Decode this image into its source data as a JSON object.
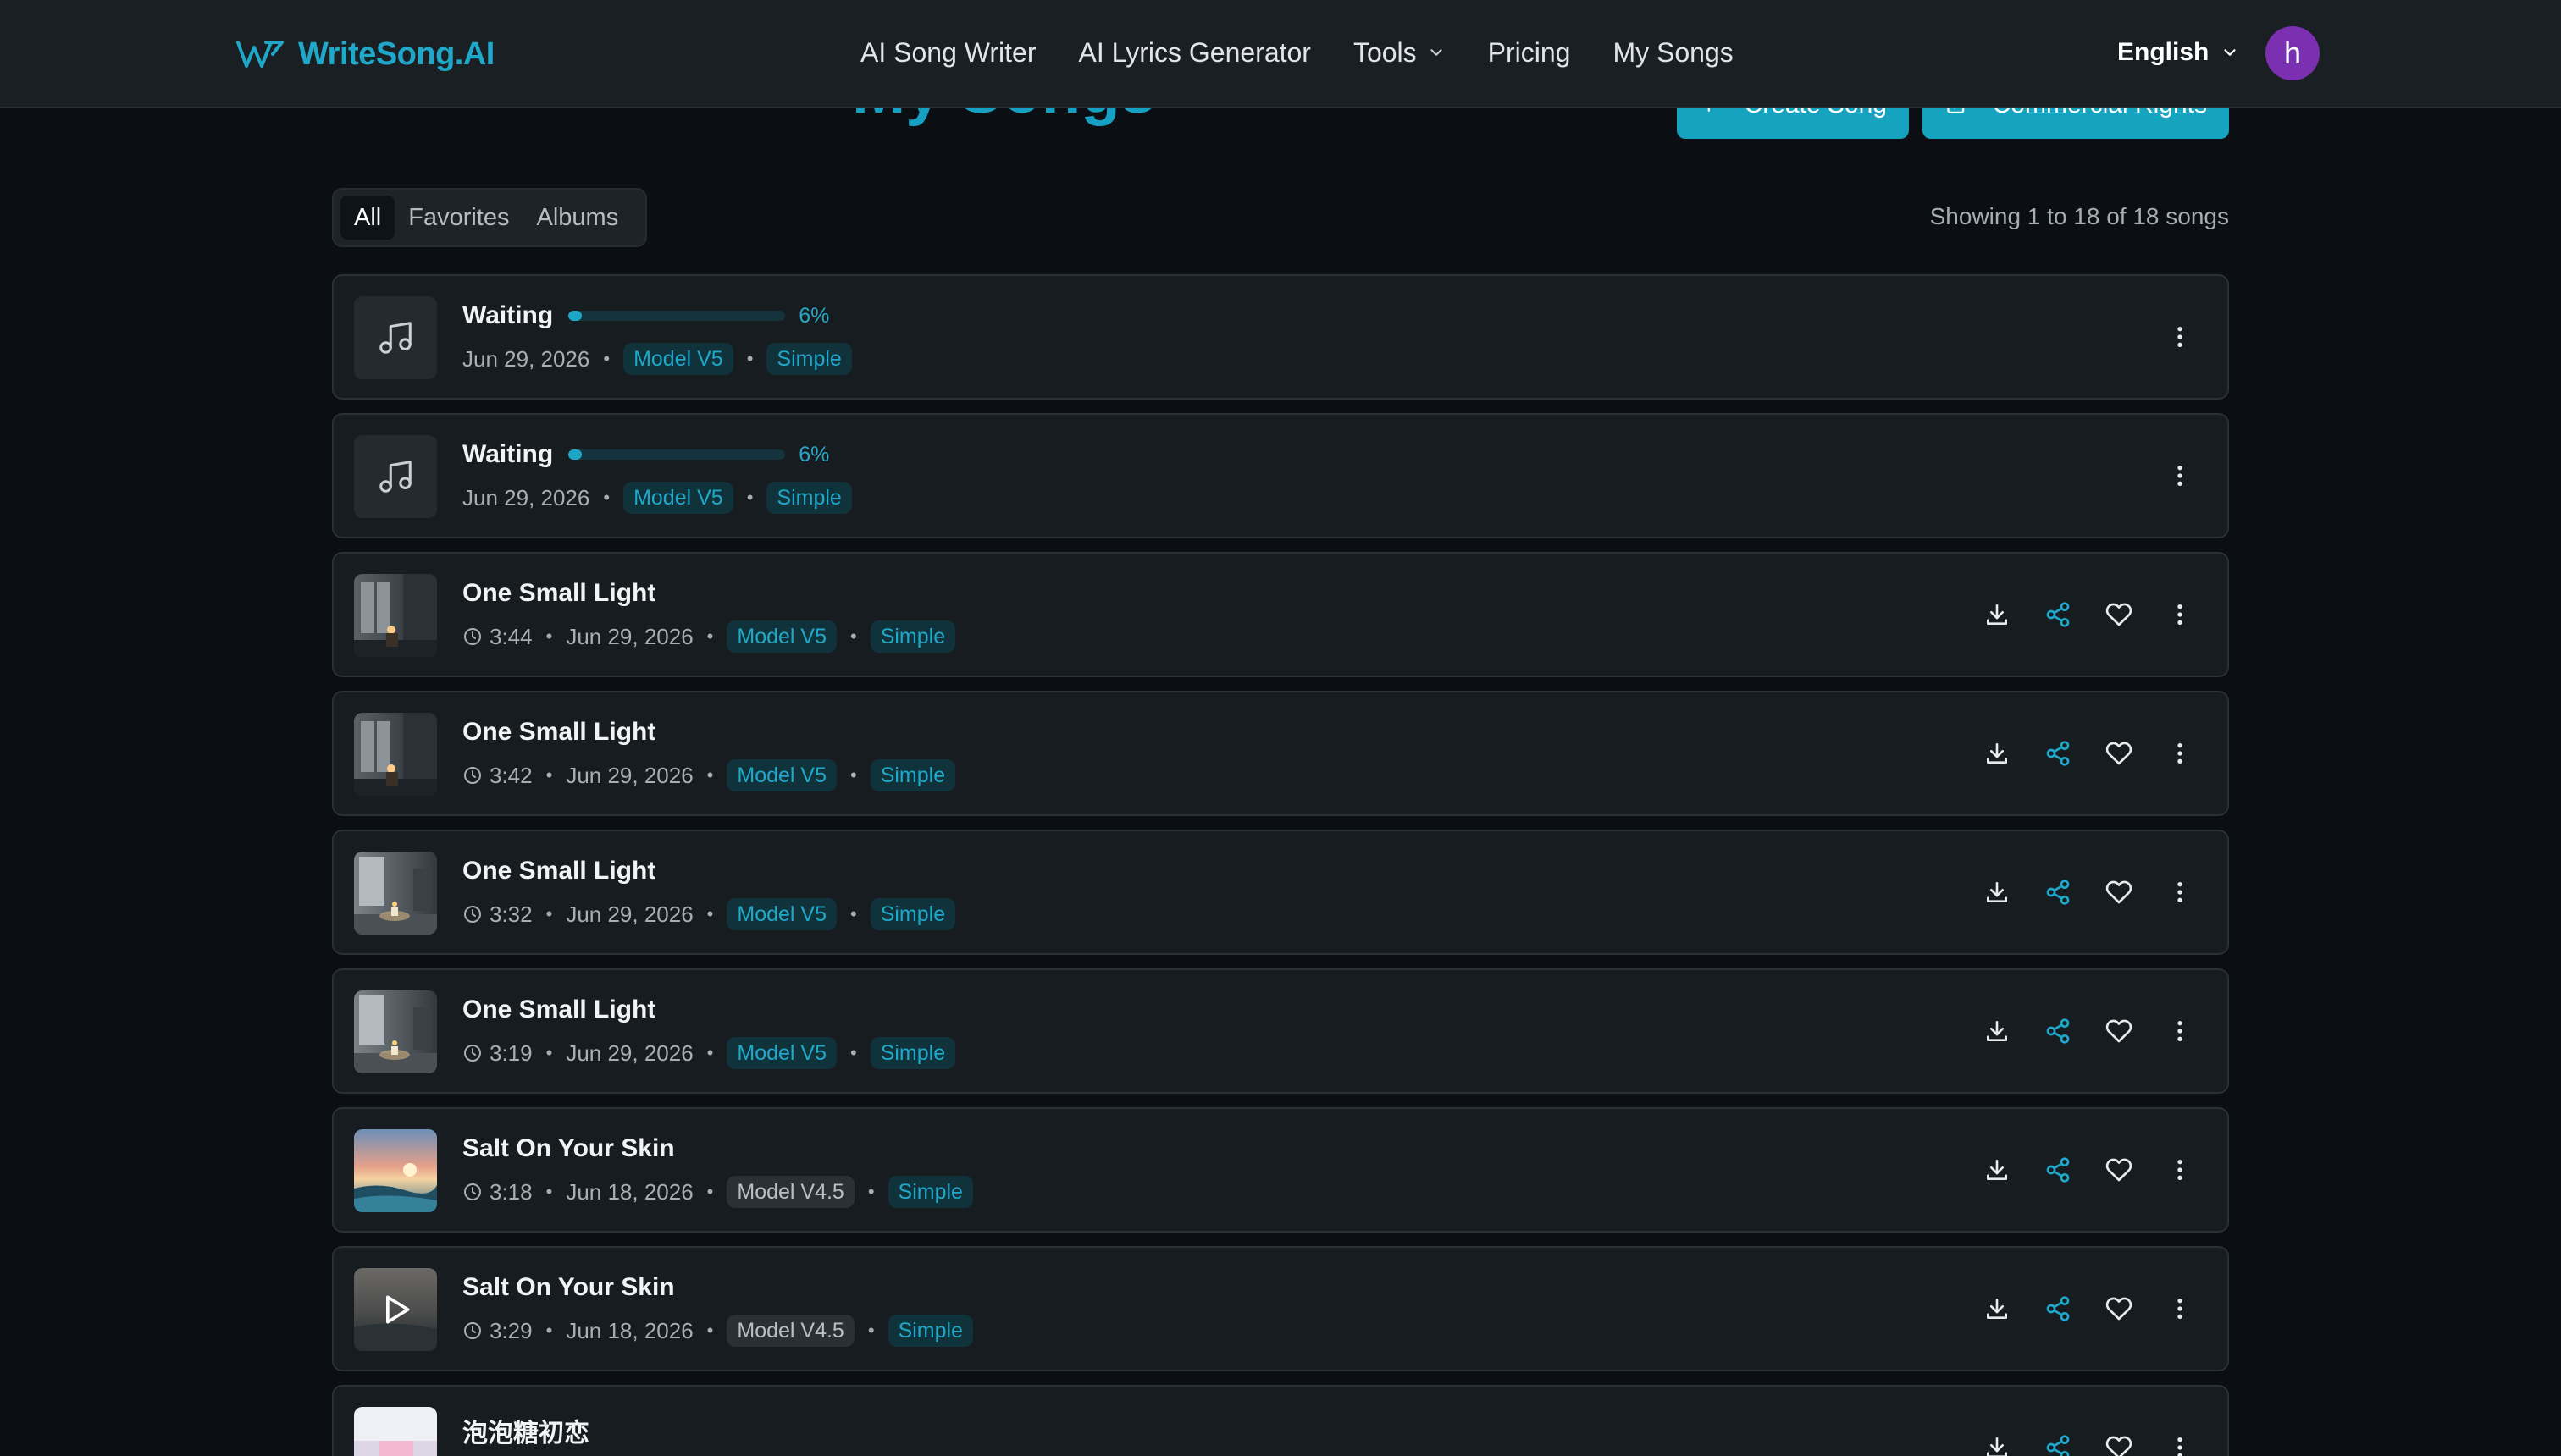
{
  "header": {
    "brand": "WriteSong.AI",
    "nav": [
      {
        "label": "AI Song Writer"
      },
      {
        "label": "AI Lyrics Generator"
      },
      {
        "label": "Tools"
      },
      {
        "label": "Pricing"
      },
      {
        "label": "My Songs"
      }
    ],
    "language": "English",
    "avatar_initial": "h",
    "avatar_color": "#7b2fb1"
  },
  "page": {
    "title": "My Songs",
    "create_button": "Create Song",
    "rights_button": "Commercial Rights"
  },
  "tabs": [
    {
      "label": "All",
      "active": true
    },
    {
      "label": "Favorites",
      "active": false
    },
    {
      "label": "Albums",
      "active": false
    }
  ],
  "showing_text": "Showing 1 to 18 of 18 songs",
  "accent_color": "#1fa8c9",
  "songs": [
    {
      "title": "Waiting",
      "status": "waiting",
      "progress_pct": 6,
      "progress_label": "6%",
      "date": "Jun 29, 2026",
      "model": "Model V5",
      "mode": "Simple"
    },
    {
      "title": "Waiting",
      "status": "waiting",
      "progress_pct": 6,
      "progress_label": "6%",
      "date": "Jun 29, 2026",
      "model": "Model V5",
      "mode": "Simple"
    },
    {
      "title": "One Small Light",
      "status": "done",
      "duration": "3:44",
      "date": "Jun 29, 2026",
      "model": "Model V5",
      "mode": "Simple",
      "thumb": "room-window"
    },
    {
      "title": "One Small Light",
      "status": "done",
      "duration": "3:42",
      "date": "Jun 29, 2026",
      "model": "Model V5",
      "mode": "Simple",
      "thumb": "room-window"
    },
    {
      "title": "One Small Light",
      "status": "done",
      "duration": "3:32",
      "date": "Jun 29, 2026",
      "model": "Model V5",
      "mode": "Simple",
      "thumb": "room-candle"
    },
    {
      "title": "One Small Light",
      "status": "done",
      "duration": "3:19",
      "date": "Jun 29, 2026",
      "model": "Model V5",
      "mode": "Simple",
      "thumb": "room-candle"
    },
    {
      "title": "Salt On Your Skin",
      "status": "done",
      "duration": "3:18",
      "date": "Jun 18, 2026",
      "model": "Model V4.5",
      "mode": "Simple",
      "thumb": "sunset-sea"
    },
    {
      "title": "Salt On Your Skin",
      "status": "done",
      "duration": "3:29",
      "date": "Jun 18, 2026",
      "model": "Model V4.5",
      "mode": "Simple",
      "thumb": "sea-dark",
      "show_play": true
    },
    {
      "title": "泡泡糖初恋",
      "status": "done",
      "thumb": "pink-room"
    }
  ]
}
